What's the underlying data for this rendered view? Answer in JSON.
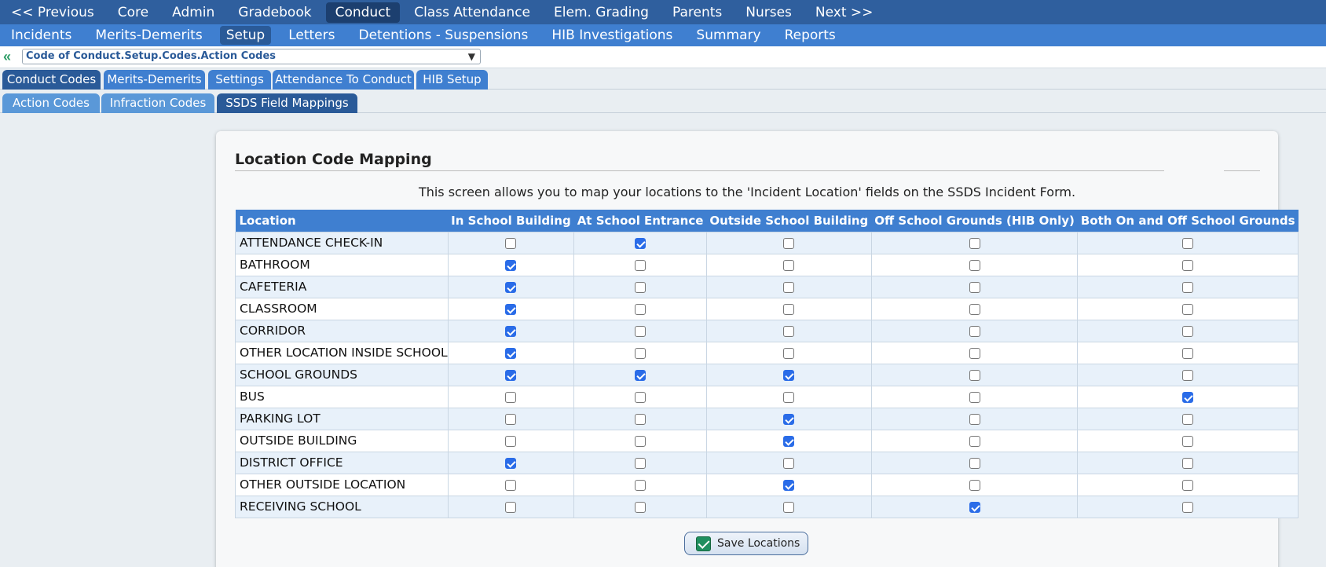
{
  "nav_primary": [
    {
      "label": "<< Previous",
      "active": false
    },
    {
      "label": "Core",
      "active": false
    },
    {
      "label": "Admin",
      "active": false
    },
    {
      "label": "Gradebook",
      "active": false
    },
    {
      "label": "Conduct",
      "active": true
    },
    {
      "label": "Class Attendance",
      "active": false
    },
    {
      "label": "Elem. Grading",
      "active": false
    },
    {
      "label": "Parents",
      "active": false
    },
    {
      "label": "Nurses",
      "active": false
    },
    {
      "label": "Next >>",
      "active": false
    }
  ],
  "nav_secondary": [
    {
      "label": "Incidents",
      "active": false
    },
    {
      "label": "Merits-Demerits",
      "active": false
    },
    {
      "label": "Setup",
      "active": true
    },
    {
      "label": "Letters",
      "active": false
    },
    {
      "label": "Detentions - Suspensions",
      "active": false
    },
    {
      "label": "HIB Investigations",
      "active": false
    },
    {
      "label": "Summary",
      "active": false
    },
    {
      "label": "Reports",
      "active": false
    }
  ],
  "breadcrumb": {
    "back_icon": "double-chevron-left-icon",
    "selected": "Code of Conduct.Setup.Codes.Action Codes"
  },
  "tabs_main": [
    {
      "label": "Conduct Codes",
      "style": "dark"
    },
    {
      "label": "Merits-Demerits",
      "style": "blue"
    },
    {
      "label": "Settings",
      "style": "blue"
    },
    {
      "label": "Attendance To Conduct",
      "style": "blue"
    },
    {
      "label": "HIB Setup",
      "style": "blue"
    }
  ],
  "tabs_sub": [
    {
      "label": "Action Codes",
      "style": "light"
    },
    {
      "label": "Infraction Codes",
      "style": "light"
    },
    {
      "label": "SSDS Field Mappings",
      "style": "dark"
    }
  ],
  "panel": {
    "title": "Location Code Mapping",
    "description": "This screen allows you to map your locations to the 'Incident Location' fields on the SSDS Incident Form."
  },
  "table": {
    "columns": [
      "Location",
      "In School Building",
      "At School Entrance",
      "Outside School Building",
      "Off School Grounds (HIB Only)",
      "Both On and Off School Grounds"
    ],
    "rows": [
      {
        "location": "ATTENDANCE CHECK-IN",
        "checks": [
          false,
          true,
          false,
          false,
          false
        ]
      },
      {
        "location": "BATHROOM",
        "checks": [
          true,
          false,
          false,
          false,
          false
        ]
      },
      {
        "location": "CAFETERIA",
        "checks": [
          true,
          false,
          false,
          false,
          false
        ]
      },
      {
        "location": "CLASSROOM",
        "checks": [
          true,
          false,
          false,
          false,
          false
        ]
      },
      {
        "location": "CORRIDOR",
        "checks": [
          true,
          false,
          false,
          false,
          false
        ]
      },
      {
        "location": "OTHER LOCATION INSIDE SCHOOL",
        "checks": [
          true,
          false,
          false,
          false,
          false
        ]
      },
      {
        "location": "SCHOOL GROUNDS",
        "checks": [
          true,
          true,
          true,
          false,
          false
        ]
      },
      {
        "location": "BUS",
        "checks": [
          false,
          false,
          false,
          false,
          true
        ]
      },
      {
        "location": "PARKING LOT",
        "checks": [
          false,
          false,
          true,
          false,
          false
        ]
      },
      {
        "location": "OUTSIDE BUILDING",
        "checks": [
          false,
          false,
          true,
          false,
          false
        ]
      },
      {
        "location": "DISTRICT OFFICE",
        "checks": [
          true,
          false,
          false,
          false,
          false
        ]
      },
      {
        "location": "OTHER OUTSIDE LOCATION",
        "checks": [
          false,
          false,
          true,
          false,
          false
        ]
      },
      {
        "location": "RECEIVING SCHOOL",
        "checks": [
          false,
          false,
          false,
          true,
          false
        ]
      }
    ]
  },
  "save_button": {
    "label": "Save Locations",
    "icon": "checkmark-icon"
  },
  "colors": {
    "nav_dark": "#2f5f9e",
    "nav_blue": "#3f7fd0",
    "checkbox_on": "#2a6ce8",
    "save_check": "#1f8f5f"
  }
}
